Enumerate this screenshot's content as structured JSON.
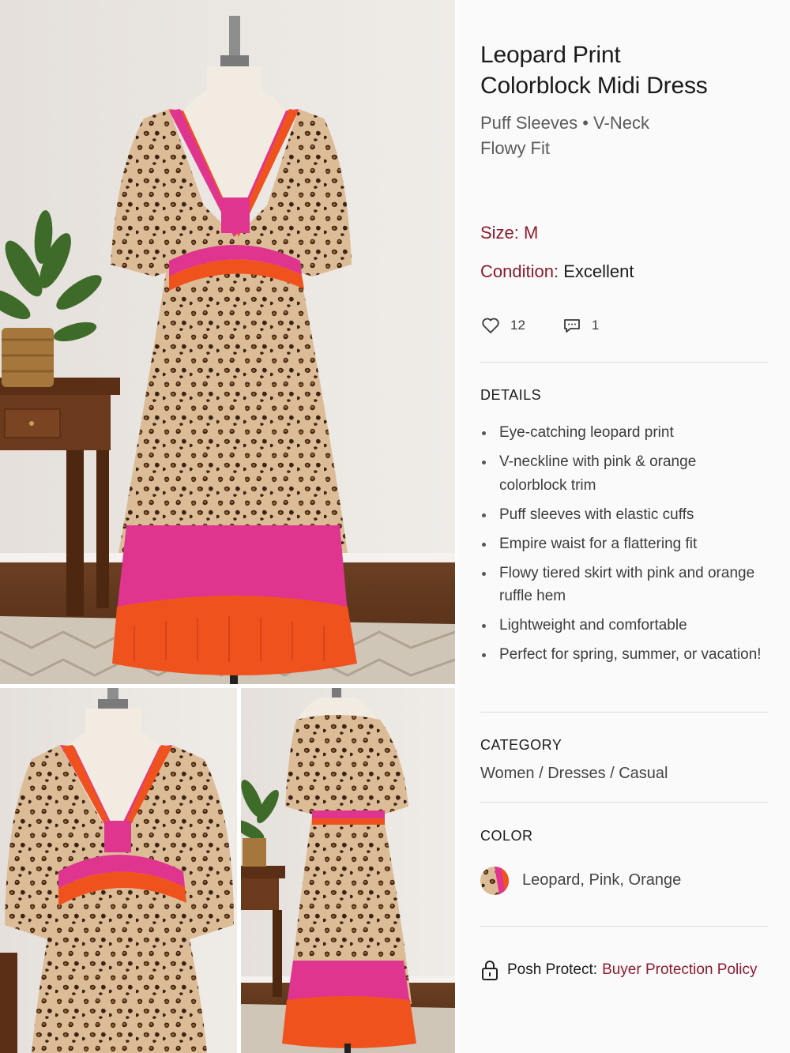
{
  "product": {
    "title_line1": "Leopard Print",
    "title_line2": "Colorblock Midi Dress",
    "subtitle_line1": "Puff Sleeves • V-Neck",
    "subtitle_line2": "Flowy Fit"
  },
  "meta": {
    "size_label": "Size:",
    "size_value": "M",
    "condition_label": "Condition:",
    "condition_value": "Excellent"
  },
  "social": {
    "likes": "12",
    "comments": "1"
  },
  "details": {
    "heading": "DETAILS",
    "items": [
      "Eye-catching leopard print",
      "V-neckline with pink & orange colorblock trim",
      "Puff sleeves with elastic cuffs",
      "Empire waist for a flattering fit",
      "Flowy tiered skirt with pink and orange ruffle hem",
      "Lightweight and comfortable",
      "Perfect for spring, summer, or vacation!"
    ]
  },
  "category": {
    "heading": "CATEGORY",
    "value": "Women / Dresses / Casual"
  },
  "color": {
    "heading": "COLOR",
    "value": "Leopard, Pink, Orange",
    "swatch_colors": [
      "#8a5a2b",
      "#e0358f",
      "#f0521e"
    ]
  },
  "protect": {
    "label": "Posh Protect:",
    "link": "Buyer Protection Policy"
  },
  "colors": {
    "accent": "#8c1b2f",
    "pink": "#e0358f",
    "orange": "#f0521e",
    "leopard_base": "#d9b894",
    "leopard_spot": "#3b2415"
  },
  "icons": {
    "likes": "heart-icon",
    "comments": "comment-icon",
    "protect": "lock-icon"
  }
}
